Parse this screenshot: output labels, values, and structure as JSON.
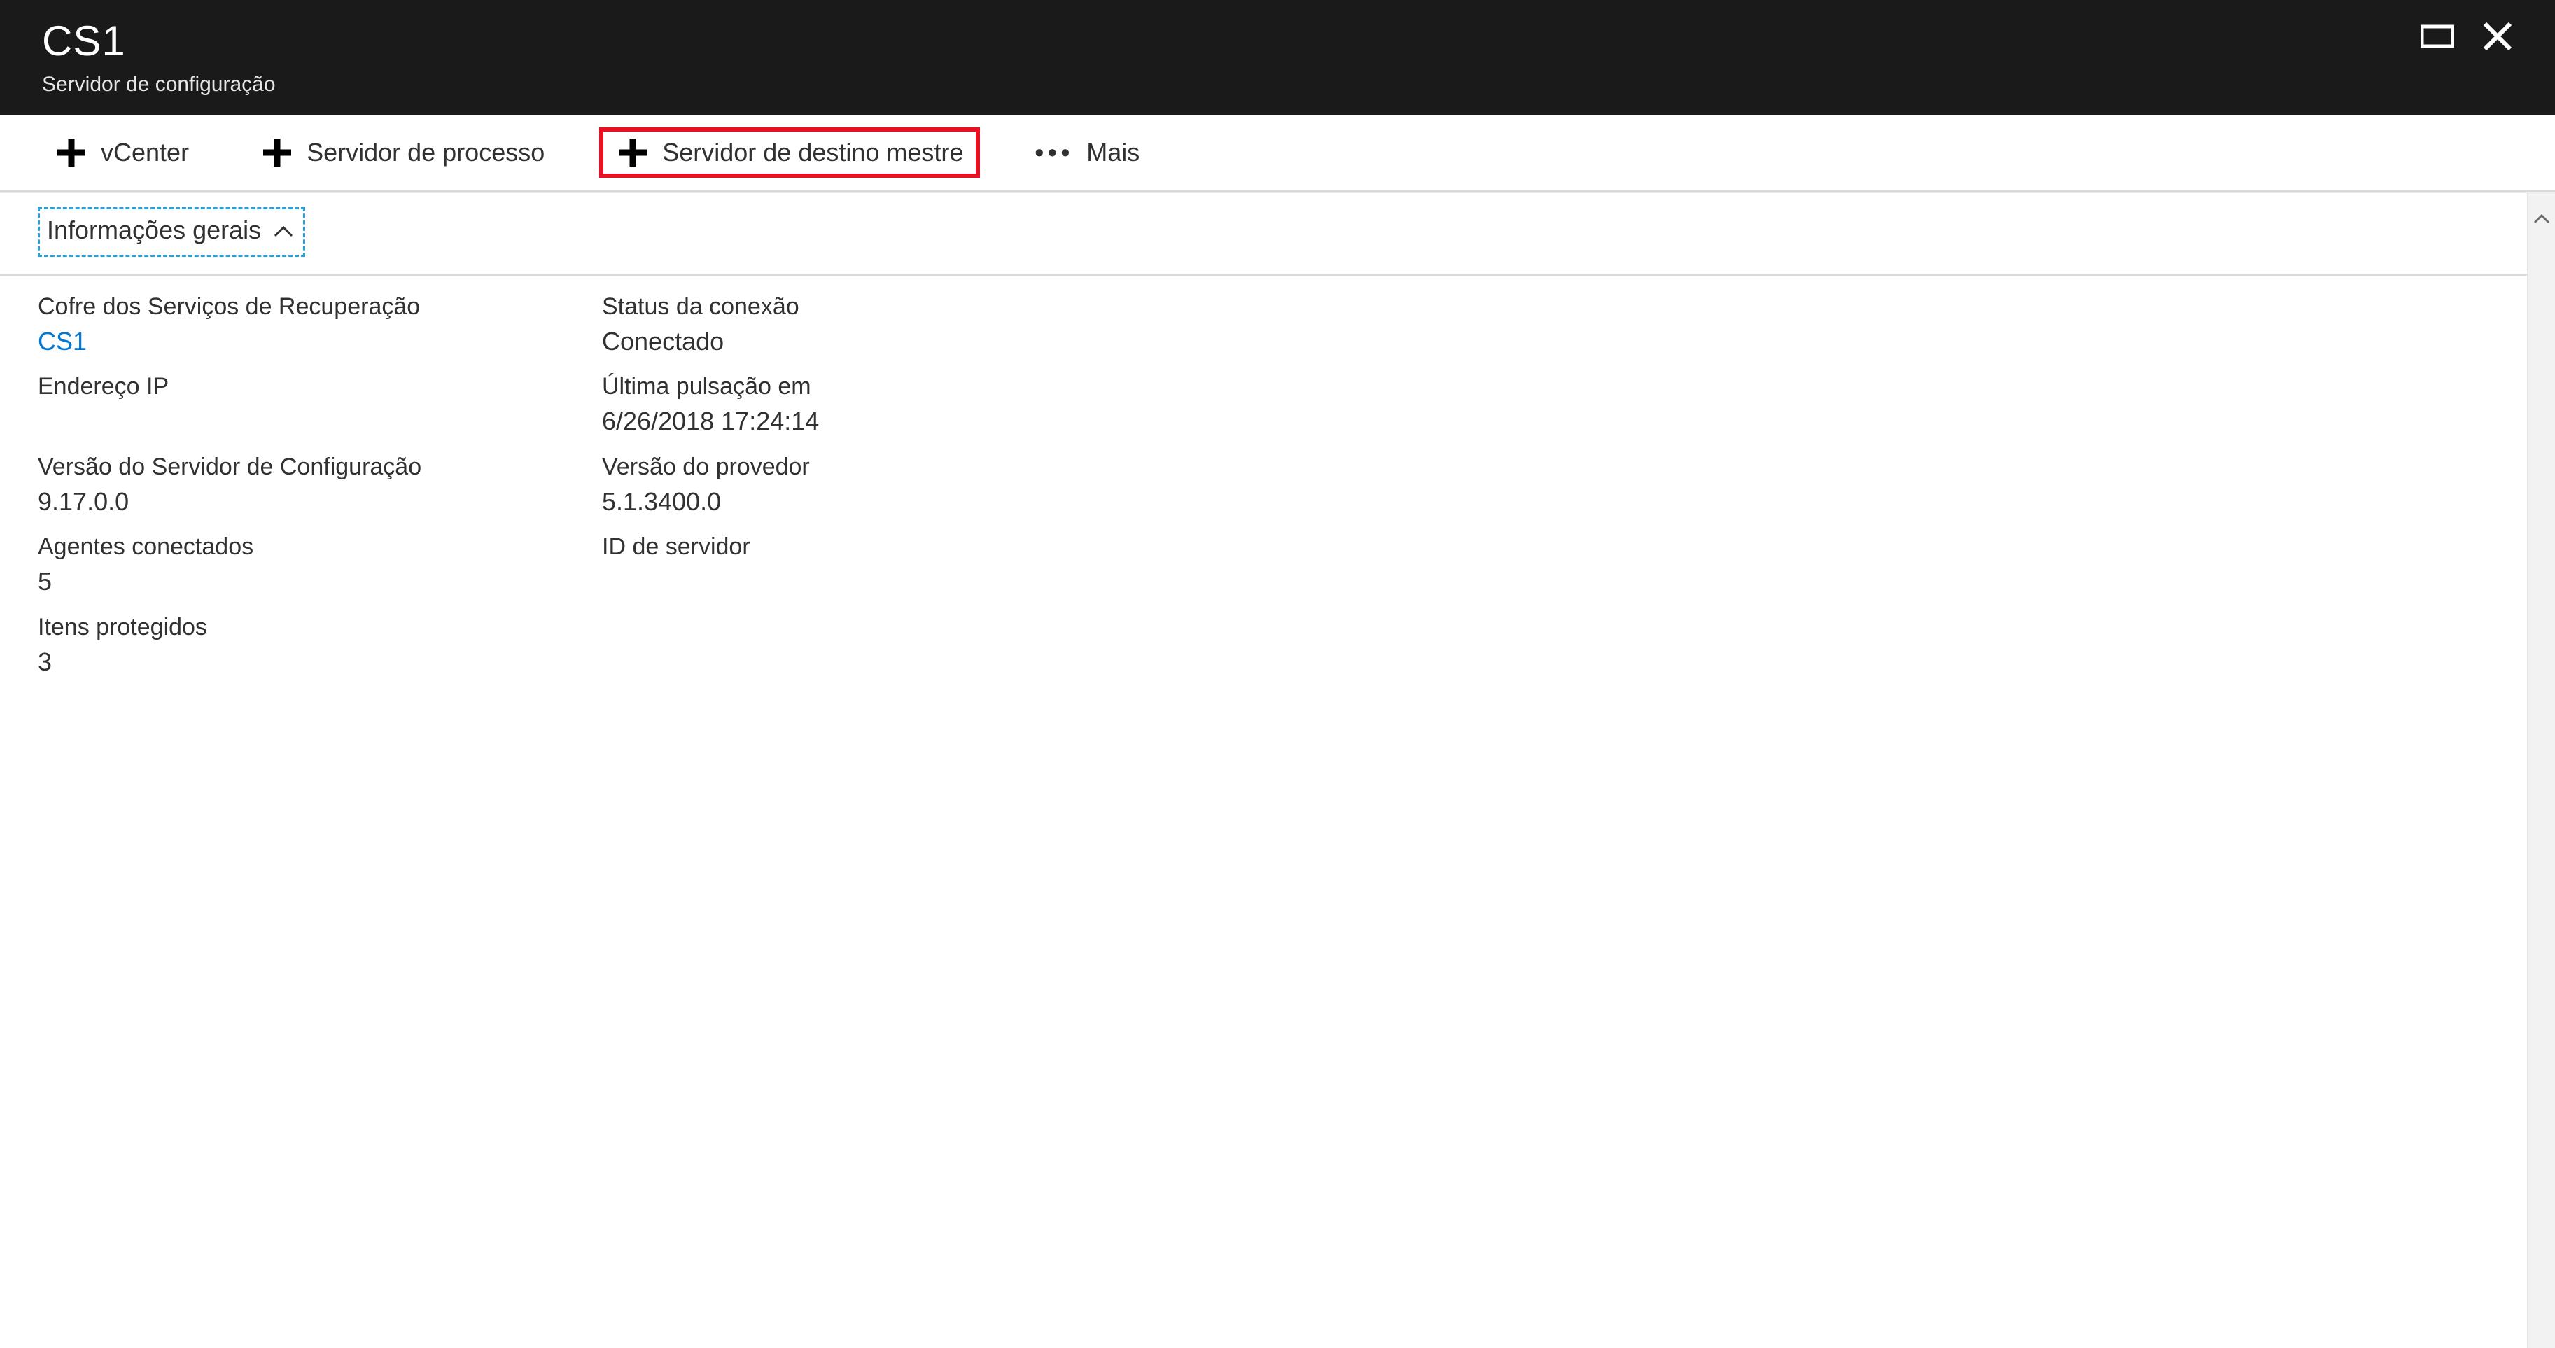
{
  "header": {
    "title": "CS1",
    "subtitle": "Servidor de configuração"
  },
  "toolbar": {
    "vcenter": "vCenter",
    "process_server": "Servidor de processo",
    "master_target": "Servidor de destino mestre",
    "more": "Mais"
  },
  "section": {
    "general_info": "Informações gerais"
  },
  "left": {
    "vault_label": "Cofre dos Serviços de Recuperação",
    "vault_value": "CS1",
    "ip_label": "Endereço IP",
    "ip_value": "",
    "cs_version_label": "Versão do Servidor de Configuração",
    "cs_version_value": "9.17.0.0",
    "agents_label": "Agentes conectados",
    "agents_value": "5",
    "protected_label": "Itens protegidos",
    "protected_value": "3"
  },
  "right": {
    "conn_status_label": "Status da conexão",
    "conn_status_value": "Conectado",
    "last_heartbeat_label": "Última pulsação em",
    "last_heartbeat_value": "6/26/2018 17:24:14",
    "provider_version_label": "Versão do provedor",
    "provider_version_value": "5.1.3400.0",
    "server_id_label": "ID de servidor",
    "server_id_value": ""
  }
}
